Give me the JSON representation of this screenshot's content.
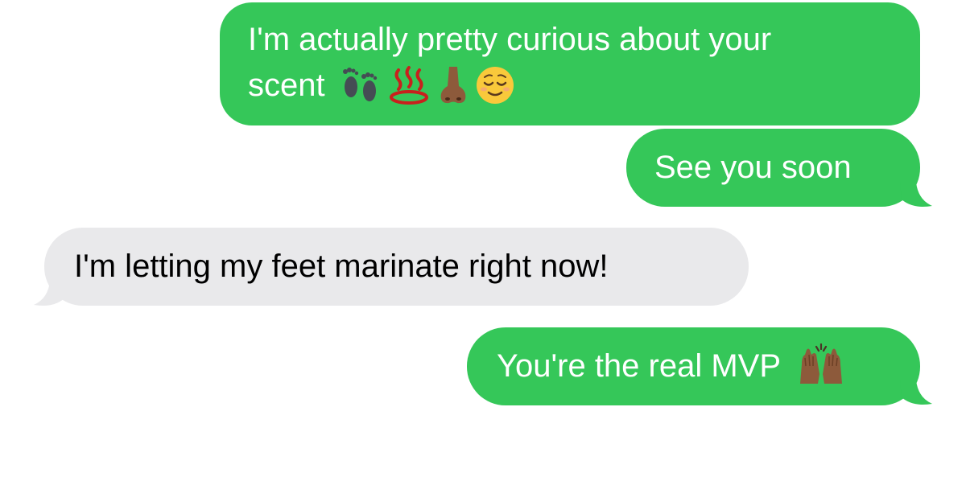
{
  "conversation": {
    "messages": [
      {
        "direction": "sent",
        "text_line1": "I'm actually pretty curious about your",
        "text_line2": "scent",
        "emojis": [
          "footprints-icon",
          "hot-springs-icon",
          "nose-icon",
          "relieved-face-icon"
        ]
      },
      {
        "direction": "sent",
        "text": "See you soon"
      },
      {
        "direction": "received",
        "text": "I'm letting my feet marinate right now!"
      },
      {
        "direction": "sent",
        "text": "You're the real MVP",
        "emojis": [
          "raising-hands-icon"
        ]
      }
    ]
  },
  "colors": {
    "sent_bubble": "#35c759",
    "received_bubble": "#e9e9eb",
    "sent_text": "#ffffff",
    "received_text": "#000000"
  }
}
